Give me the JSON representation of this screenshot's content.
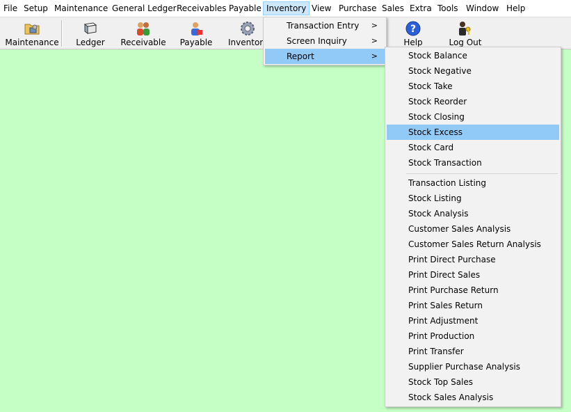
{
  "menubar": {
    "items": [
      "File",
      "Setup",
      "Maintenance",
      "General Ledger",
      "Receivables",
      "Payable",
      "Inventory",
      "View",
      "Purchase",
      "Sales",
      "Extra",
      "Tools",
      "Window",
      "Help"
    ],
    "active_index": 6
  },
  "toolbar": {
    "buttons": [
      {
        "label": "Maintenance",
        "icon": "folder-settings-icon"
      },
      {
        "label": "Ledger",
        "icon": "ledger-book-icon"
      },
      {
        "label": "Receivable",
        "icon": "people-group-icon"
      },
      {
        "label": "Payable",
        "icon": "person-payable-icon"
      },
      {
        "label": "Inventor",
        "icon": "gear-icon"
      },
      {
        "label": "Help",
        "icon": "help-icon"
      },
      {
        "label": "Log Out",
        "icon": "logout-person-key-icon"
      }
    ]
  },
  "inventory_menu": {
    "items": [
      {
        "label": "Transaction Entry",
        "submenu": true
      },
      {
        "label": "Screen Inquiry",
        "submenu": true
      },
      {
        "label": "Report",
        "submenu": true
      }
    ],
    "active_index": 2
  },
  "report_menu": {
    "group1": [
      "Stock Balance",
      "Stock Negative",
      "Stock Take",
      "Stock Reorder",
      "Stock Closing",
      "Stock Excess",
      "Stock Card",
      "Stock Transaction"
    ],
    "group2": [
      "Transaction Listing",
      "Stock Listing",
      "Stock Analysis",
      "Customer Sales Analysis",
      "Customer Sales Return Analysis",
      "Print Direct Purchase",
      "Print Direct Sales",
      "Print Purchase Return",
      "Print Sales Return",
      "Print Adjustment",
      "Print Production",
      "Print Transfer",
      "Supplier Purchase Analysis",
      "Stock Top Sales",
      "Stock Sales Analysis"
    ],
    "highlighted": "Stock Excess"
  },
  "colors": {
    "workspace_bg": "#c5ffc5",
    "menu_highlight": "#91c9f7",
    "menubar_active": "#cce8ff"
  }
}
